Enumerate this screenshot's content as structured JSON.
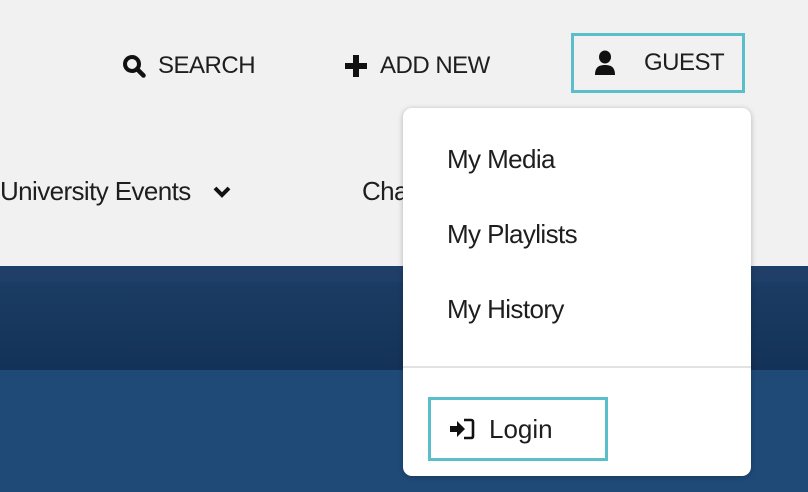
{
  "header": {
    "search_label": "SEARCH",
    "add_new_label": "ADD NEW",
    "guest_label": "GUEST"
  },
  "nav": {
    "university_events": "University Events",
    "cha_partial": "Cha"
  },
  "user_menu": {
    "items": [
      {
        "label": "My Media"
      },
      {
        "label": "My Playlists"
      },
      {
        "label": "My History"
      }
    ],
    "login_label": "Login"
  },
  "colors": {
    "highlight_border": "#5bbfcb",
    "banner_dark": "#143257",
    "banner_light": "#1f4a78"
  },
  "icons": {
    "search": "search-icon",
    "add": "plus-icon",
    "user": "user-icon",
    "chevron": "chevron-down-icon",
    "login": "sign-in-icon"
  }
}
